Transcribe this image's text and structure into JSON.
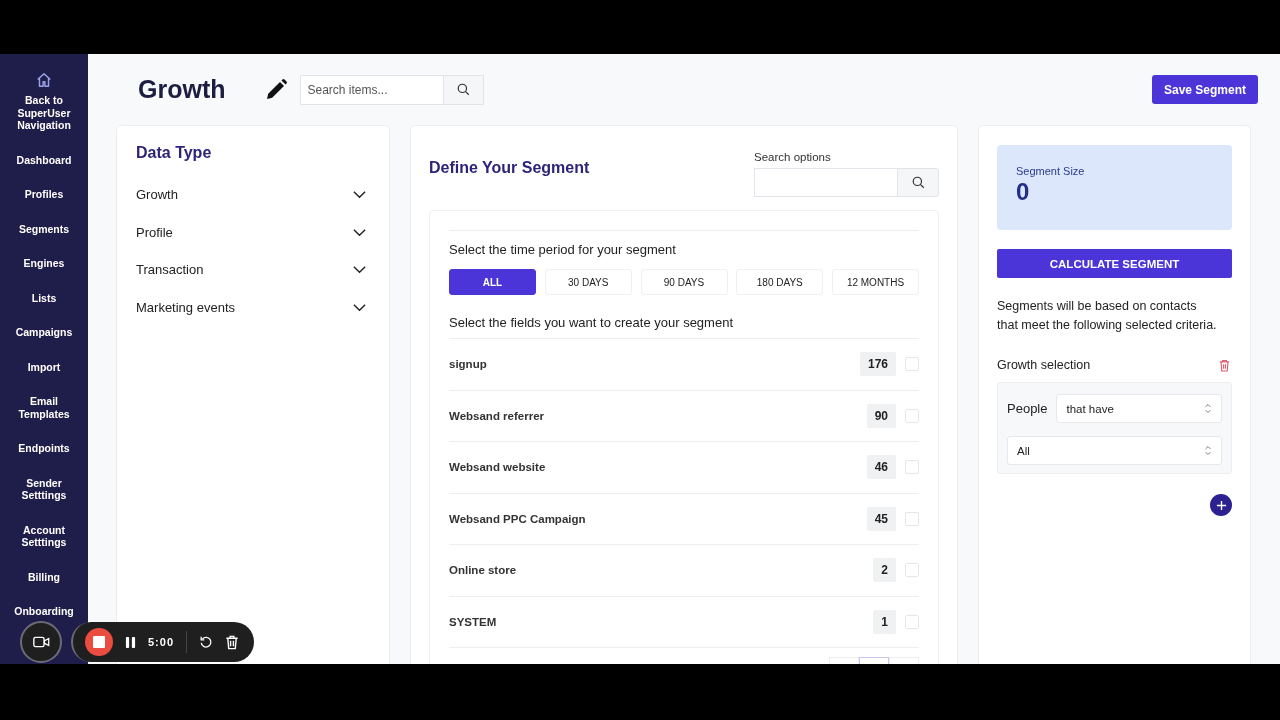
{
  "sidebar": {
    "items": [
      {
        "label": "Back to SuperUser Navigation",
        "kind": "home"
      },
      {
        "label": "Dashboard",
        "kind": "link"
      },
      {
        "label": "Profiles",
        "kind": "link"
      },
      {
        "label": "Segments",
        "kind": "link"
      },
      {
        "label": "Engines",
        "kind": "link"
      },
      {
        "label": "Lists",
        "kind": "link"
      },
      {
        "label": "Campaigns",
        "kind": "link"
      },
      {
        "label": "Import",
        "kind": "link"
      },
      {
        "label": "Email Templates",
        "kind": "link"
      },
      {
        "label": "Endpoints",
        "kind": "link"
      },
      {
        "label": "Sender Setttings",
        "kind": "link"
      },
      {
        "label": "Account Setttings",
        "kind": "link"
      },
      {
        "label": "Billing",
        "kind": "link"
      },
      {
        "label": "Onboarding",
        "kind": "link"
      }
    ]
  },
  "header": {
    "title": "Growth",
    "search": {
      "placeholder": "Search items..."
    },
    "save_button": "Save Segment"
  },
  "data_type": {
    "title": "Data Type",
    "groups": [
      {
        "label": "Growth",
        "expanded": false
      },
      {
        "label": "Profile",
        "expanded": false
      },
      {
        "label": "Transaction",
        "expanded": false
      },
      {
        "label": "Marketing events",
        "expanded": false
      }
    ]
  },
  "define": {
    "title": "Define Your Segment",
    "search_label": "Search options",
    "time_prompt": "Select the time period for your segment",
    "periods": [
      {
        "label": "ALL",
        "selected": true
      },
      {
        "label": "30 DAYS",
        "selected": false
      },
      {
        "label": "90 DAYS",
        "selected": false
      },
      {
        "label": "180 DAYS",
        "selected": false
      },
      {
        "label": "12 MONTHS",
        "selected": false
      }
    ],
    "fields_prompt": "Select the fields you want to create your segment",
    "fields": [
      {
        "name": "signup",
        "count": "176",
        "checked": false
      },
      {
        "name": "Websand referrer",
        "count": "90",
        "checked": false
      },
      {
        "name": "Websand website",
        "count": "46",
        "checked": false
      },
      {
        "name": "Websand PPC Campaign",
        "count": "45",
        "checked": false
      },
      {
        "name": "Online store",
        "count": "2",
        "checked": false
      },
      {
        "name": "SYSTEM",
        "count": "1",
        "checked": false
      }
    ]
  },
  "summary": {
    "size_label": "Segment Size",
    "size": "0",
    "calculate_button": "CALCULATE SEGMENT",
    "note": "Segments will be based on contacts that meet the following selected criteria.",
    "selection_title": "Growth selection",
    "criteria": {
      "subject": "People",
      "condition": "that have",
      "scope": "All"
    }
  },
  "recorder": {
    "time": "5:00"
  }
}
